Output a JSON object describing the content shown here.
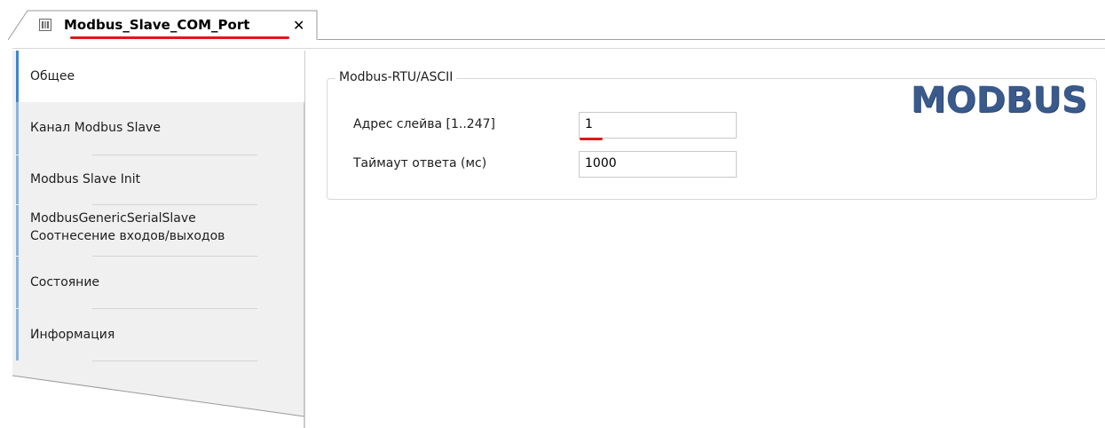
{
  "tab": {
    "title": "Modbus_Slave_COM_Port",
    "close_glyph": "✕",
    "icon": "device-module-icon"
  },
  "sidebar": {
    "items": [
      {
        "label": "Общее",
        "active": true
      },
      {
        "label": "Канал Modbus Slave",
        "active": false
      },
      {
        "label": "Modbus Slave Init",
        "active": false
      },
      {
        "label_line1": "ModbusGenericSerialSlave",
        "label_line2": "Соотнесение входов/выходов",
        "active": false
      },
      {
        "label": "Состояние",
        "active": false
      },
      {
        "label": "Информация",
        "active": false
      }
    ]
  },
  "main": {
    "group_title": "Modbus-RTU/ASCII",
    "logo_text": "MODBUS",
    "fields": [
      {
        "label": "Адрес слейва [1..247]",
        "value": "1"
      },
      {
        "label": "Таймаут ответа (мс)",
        "value": "1000"
      }
    ]
  },
  "colors": {
    "highlight_red": "#e01818",
    "active_bar": "#3f86d0",
    "inactive_bar": "#8ab4dc",
    "logo_blue": "#3a5a8c"
  }
}
